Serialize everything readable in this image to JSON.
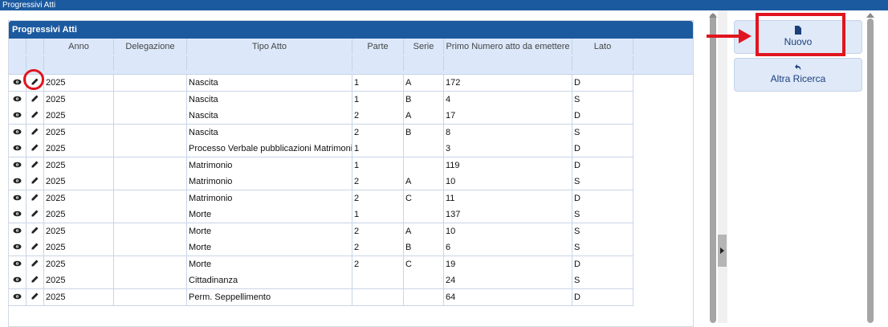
{
  "window": {
    "title": "Progressivi Atti"
  },
  "panel": {
    "title": "Progressivi Atti"
  },
  "columns": [
    {
      "label": ""
    },
    {
      "label": ""
    },
    {
      "label": "Anno"
    },
    {
      "label": "Delegazione"
    },
    {
      "label": "Tipo Atto"
    },
    {
      "label": "Parte"
    },
    {
      "label": "Serie"
    },
    {
      "label": "Primo Numero atto da emettere"
    },
    {
      "label": "Lato"
    }
  ],
  "rows": [
    {
      "anno": "2025",
      "delegazione": "",
      "tipo": "Nascita",
      "parte": "1",
      "serie": "A",
      "numero": "172",
      "lato": "D"
    },
    {
      "anno": "2025",
      "delegazione": "",
      "tipo": "Nascita",
      "parte": "1",
      "serie": "B",
      "numero": "4",
      "lato": "S"
    },
    {
      "anno": "2025",
      "delegazione": "",
      "tipo": "Nascita",
      "parte": "2",
      "serie": "A",
      "numero": "17",
      "lato": "D"
    },
    {
      "anno": "2025",
      "delegazione": "",
      "tipo": "Nascita",
      "parte": "2",
      "serie": "B",
      "numero": "8",
      "lato": "S"
    },
    {
      "anno": "2025",
      "delegazione": "",
      "tipo": "Processo Verbale pubblicazioni Matrimonio",
      "parte": "1",
      "serie": "",
      "numero": "3",
      "lato": "D"
    },
    {
      "anno": "2025",
      "delegazione": "",
      "tipo": "Matrimonio",
      "parte": "1",
      "serie": "",
      "numero": "119",
      "lato": "D"
    },
    {
      "anno": "2025",
      "delegazione": "",
      "tipo": "Matrimonio",
      "parte": "2",
      "serie": "A",
      "numero": "10",
      "lato": "S"
    },
    {
      "anno": "2025",
      "delegazione": "",
      "tipo": "Matrimonio",
      "parte": "2",
      "serie": "C",
      "numero": "11",
      "lato": "D"
    },
    {
      "anno": "2025",
      "delegazione": "",
      "tipo": "Morte",
      "parte": "1",
      "serie": "",
      "numero": "137",
      "lato": "S"
    },
    {
      "anno": "2025",
      "delegazione": "",
      "tipo": "Morte",
      "parte": "2",
      "serie": "A",
      "numero": "10",
      "lato": "S"
    },
    {
      "anno": "2025",
      "delegazione": "",
      "tipo": "Morte",
      "parte": "2",
      "serie": "B",
      "numero": "6",
      "lato": "S"
    },
    {
      "anno": "2025",
      "delegazione": "",
      "tipo": "Morte",
      "parte": "2",
      "serie": "C",
      "numero": "19",
      "lato": "D"
    },
    {
      "anno": "2025",
      "delegazione": "",
      "tipo": "Cittadinanza",
      "parte": "",
      "serie": "",
      "numero": "24",
      "lato": "S"
    },
    {
      "anno": "2025",
      "delegazione": "",
      "tipo": "Perm. Seppellimento",
      "parte": "",
      "serie": "",
      "numero": "64",
      "lato": "D"
    }
  ],
  "buttons": {
    "nuovo": {
      "label": "Nuovo",
      "icon": "file-icon"
    },
    "altra_ricerca": {
      "label": "Altra Ricerca",
      "icon": "undo-icon"
    }
  },
  "colors": {
    "header_blue": "#1c5aa0",
    "grid_header": "#dce8fa",
    "annotation_red": "#e0151f"
  }
}
